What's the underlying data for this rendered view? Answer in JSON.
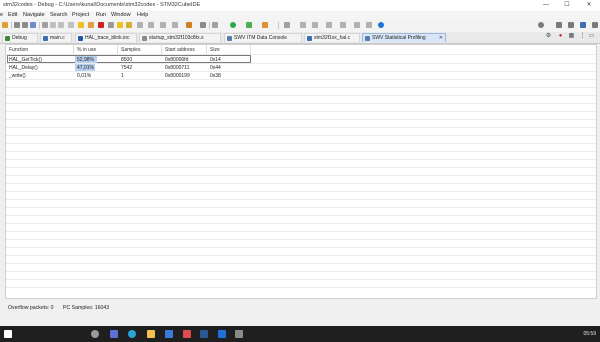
{
  "window": {
    "title": "stm32codes - Debug - C:\\Users\\kunal\\Documents\\stm32codes - STM32CubeIDE",
    "minimize": "—",
    "maximize": "☐",
    "close": "✕"
  },
  "menu": [
    "e",
    "Edit",
    "Navigate",
    "Search",
    "Project",
    "Run",
    "Window",
    "Help"
  ],
  "tabs": [
    {
      "label": "Debug",
      "close": ""
    },
    {
      "label": "main.c",
      "close": ""
    },
    {
      "label": "HAL_trace_blink.ioc",
      "close": ""
    },
    {
      "label": "startup_stm32f103c8tx.s",
      "close": ""
    },
    {
      "label": "SWV ITM Data Console",
      "close": ""
    },
    {
      "label": "stm32f1xx_hal.c",
      "close": ""
    },
    {
      "label": "SWV Statistical Profiling",
      "close": "✕"
    }
  ],
  "table": {
    "headers": [
      "Function",
      "% in use",
      "Samples",
      "Start address",
      "Size"
    ],
    "rows": [
      {
        "function": "HAL_GetTick()",
        "percent": "52,98%",
        "percent_value": 52.98,
        "samples": "8500",
        "start": "0x80006fd",
        "size": "0x14"
      },
      {
        "function": "HAL_Delay()",
        "percent": "47,01%",
        "percent_value": 47.01,
        "samples": "7542",
        "start": "0x8000711",
        "size": "0x44"
      },
      {
        "function": "_write()",
        "percent": "0,01%",
        "percent_value": 0.01,
        "samples": "1",
        "start": "0x8000199",
        "size": "0x38"
      }
    ]
  },
  "status": {
    "overflow": "Overflow packets: 0",
    "pc_samples": "PC Samples: 16043"
  },
  "taskbar": {
    "clock": "05:59"
  },
  "colors": {
    "selected_tab": "#d7e6f8",
    "percent_bar": "#b9d1ee",
    "taskbar": "#1f1f1f"
  }
}
